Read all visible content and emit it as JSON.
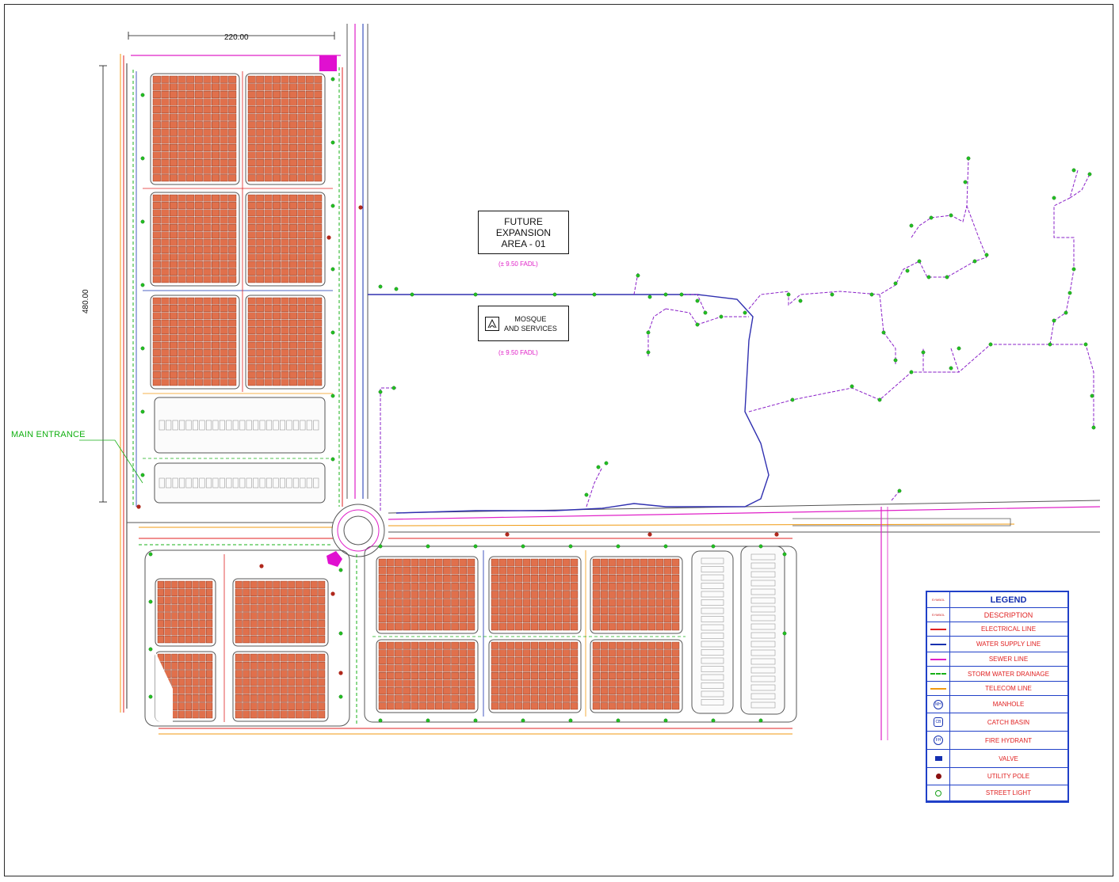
{
  "dimensions": {
    "width_label": "220.00",
    "height_label": "480.00"
  },
  "labels": {
    "main_entrance": "MAIN ENTRANCE",
    "future_expansion": {
      "line1": "FUTURE",
      "line2": "EXPANSION",
      "line3": "AREA - 01",
      "area": "(± 9.50 FADL)"
    },
    "mosque": {
      "line1": "MOSQUE",
      "line2": "AND SERVICES",
      "area": "(± 9.50 FADL)"
    }
  },
  "legend": {
    "title": "LEGEND",
    "symbol_header": "SYMBOL",
    "description_header": "DESCRIPTION",
    "items": [
      {
        "label": "ELECTRICAL LINE",
        "icon": "electrical-line",
        "color": "#e02020"
      },
      {
        "label": "WATER SUPPLY LINE",
        "icon": "water-supply-line",
        "color": "#1530b0"
      },
      {
        "label": "SEWER LINE",
        "icon": "sewer-line",
        "color": "#e020c8"
      },
      {
        "label": "STORM WATER DRAINAGE",
        "icon": "storm-drainage-line",
        "color": "#18b018"
      },
      {
        "label": "TELECOM LINE",
        "icon": "telecom-line",
        "color": "#f09a10"
      },
      {
        "label": "MANHOLE",
        "icon": "manhole-icon",
        "symbol_text": "MH"
      },
      {
        "label": "CATCH BASIN",
        "icon": "catch-basin-icon",
        "symbol_text": "CB"
      },
      {
        "label": "FIRE HYDRANT",
        "icon": "fire-hydrant-icon",
        "symbol_text": "FH"
      },
      {
        "label": "VALVE",
        "icon": "valve-icon"
      },
      {
        "label": "UTILITY POLE",
        "icon": "utility-pole-icon"
      },
      {
        "label": "STREET LIGHT",
        "icon": "street-light-icon"
      }
    ]
  },
  "colors": {
    "plot": "#e0704c",
    "plot_edge": "#8a2a10",
    "electrical": "#e02020",
    "water": "#1530b0",
    "sewer": "#e020c8",
    "storm": "#18b018",
    "telecom": "#f09a10",
    "road": "#555555"
  }
}
